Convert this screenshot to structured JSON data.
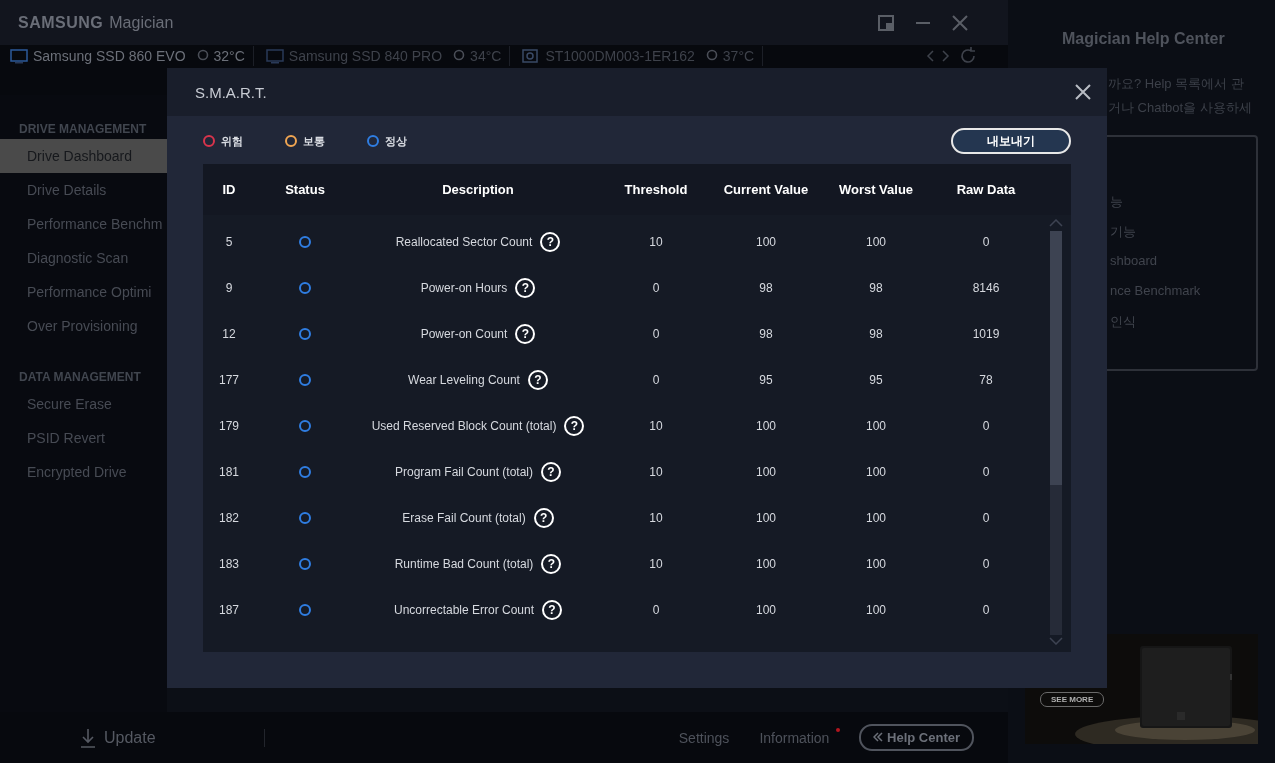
{
  "window": {
    "title_brand": "SAMSUNG",
    "title_app": "Magician"
  },
  "drives": [
    {
      "name": "Samsung SSD 860 EVO",
      "temp": "32°C",
      "kind": "ssd",
      "selected": true
    },
    {
      "name": "Samsung SSD 840 PRO",
      "temp": "34°C",
      "kind": "ssd",
      "selected": false
    },
    {
      "name": "ST1000DM003-1ER162",
      "temp": "37°C",
      "kind": "hdd",
      "selected": false
    }
  ],
  "sidebar": {
    "sections": [
      {
        "heading": "DRIVE MANAGEMENT",
        "items": [
          {
            "label": "Drive Dashboard",
            "selected": true
          },
          {
            "label": "Drive Details",
            "selected": false
          },
          {
            "label": "Performance Benchm",
            "selected": false
          },
          {
            "label": "Diagnostic Scan",
            "selected": false
          },
          {
            "label": "Performance Optimi",
            "selected": false
          },
          {
            "label": "Over Provisioning",
            "selected": false
          }
        ]
      },
      {
        "heading": "DATA MANAGEMENT",
        "items": [
          {
            "label": "Secure Erase",
            "selected": false
          },
          {
            "label": "PSID Revert",
            "selected": false
          },
          {
            "label": "Encrypted Drive",
            "selected": false
          }
        ]
      }
    ]
  },
  "help_panel": {
    "title": "Magician Help Center",
    "intro": [
      "까요? Help 목록에서 관",
      "거나 Chatbot을 사용하세"
    ],
    "items": [
      "능",
      "기능",
      "shboard",
      "nce Benchmark",
      "인식"
    ],
    "promo": {
      "kind": "picture",
      "button": "SEE MORE"
    }
  },
  "bottom_bar": {
    "update": "Update",
    "links": [
      {
        "label": "Settings",
        "alert": false
      },
      {
        "label": "Information",
        "alert": true
      }
    ],
    "help_button": "Help Center"
  },
  "dialog": {
    "title": "S.M.A.R.T.",
    "legend": [
      {
        "label": "위험",
        "color": "#d8344c"
      },
      {
        "label": "보통",
        "color": "#f0a552"
      },
      {
        "label": "정상",
        "color": "#2f7de1"
      }
    ],
    "export_button": "내보내기",
    "table": {
      "columns": [
        "ID",
        "Status",
        "Description",
        "Threshold",
        "Current Value",
        "Worst Value",
        "Raw Data"
      ],
      "rows": [
        {
          "id": "5",
          "color": "#2f7de1",
          "description": "Reallocated Sector Count",
          "help": "?",
          "threshold": "10",
          "current": "100",
          "worst": "100",
          "raw": "0"
        },
        {
          "id": "9",
          "color": "#2f7de1",
          "description": "Power-on Hours",
          "help": "?",
          "threshold": "0",
          "current": "98",
          "worst": "98",
          "raw": "8146"
        },
        {
          "id": "12",
          "color": "#2f7de1",
          "description": "Power-on Count",
          "help": "?",
          "threshold": "0",
          "current": "98",
          "worst": "98",
          "raw": "1019"
        },
        {
          "id": "177",
          "color": "#2f7de1",
          "description": "Wear Leveling Count",
          "help": "?",
          "threshold": "0",
          "current": "95",
          "worst": "95",
          "raw": "78"
        },
        {
          "id": "179",
          "color": "#2f7de1",
          "description": "Used Reserved Block Count (total)",
          "help": "?",
          "threshold": "10",
          "current": "100",
          "worst": "100",
          "raw": "0"
        },
        {
          "id": "181",
          "color": "#2f7de1",
          "description": "Program Fail Count (total)",
          "help": "?",
          "threshold": "10",
          "current": "100",
          "worst": "100",
          "raw": "0"
        },
        {
          "id": "182",
          "color": "#2f7de1",
          "description": "Erase Fail Count (total)",
          "help": "?",
          "threshold": "10",
          "current": "100",
          "worst": "100",
          "raw": "0"
        },
        {
          "id": "183",
          "color": "#2f7de1",
          "description": "Runtime Bad Count (total)",
          "help": "?",
          "threshold": "10",
          "current": "100",
          "worst": "100",
          "raw": "0"
        },
        {
          "id": "187",
          "color": "#2f7de1",
          "description": "Uncorrectable Error Count",
          "help": "?",
          "threshold": "0",
          "current": "100",
          "worst": "100",
          "raw": "0"
        }
      ]
    }
  }
}
